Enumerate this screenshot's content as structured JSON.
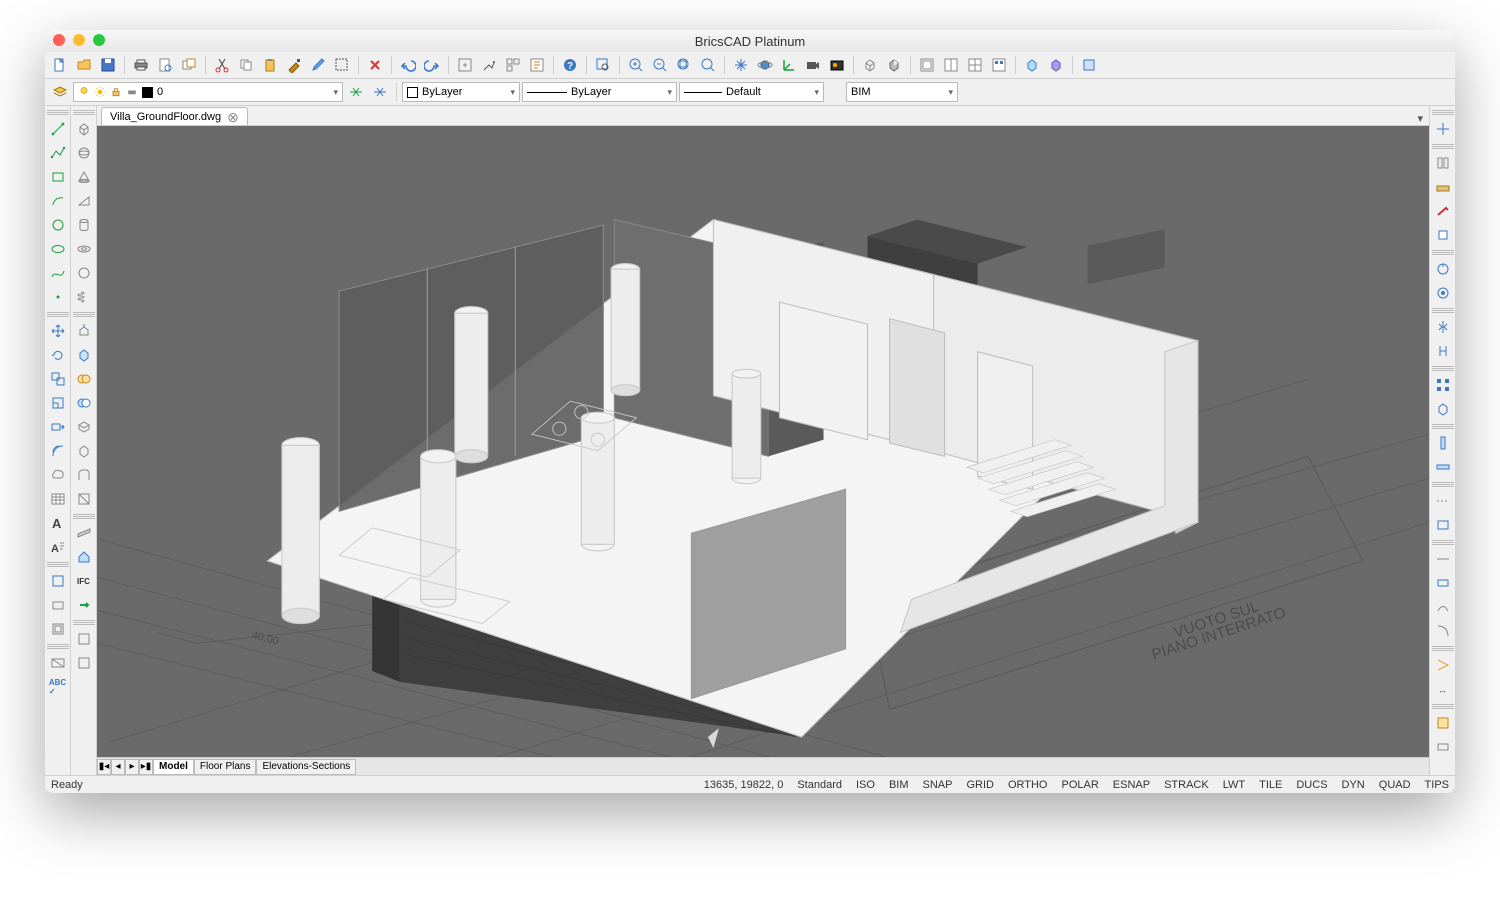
{
  "app_title": "BricsCAD Platinum",
  "document_tab": "Villa_GroundFloor.dwg",
  "workspace": "BIM",
  "layer_combo": "0",
  "color_combo": "ByLayer",
  "linetype_combo": "ByLayer",
  "lineweight_combo": "Default",
  "layout_tabs": {
    "active": "Model",
    "others": [
      "Floor Plans",
      "Elevations-Sections"
    ]
  },
  "status_left": "Ready",
  "status_coords": "13635, 19822, 0",
  "status_toggles": [
    "Standard",
    "ISO",
    "BIM",
    "SNAP",
    "GRID",
    "ORTHO",
    "POLAR",
    "ESNAP",
    "STRACK",
    "LWT",
    "TILE",
    "DUCS",
    "DYN",
    "QUAD",
    "TIPS"
  ],
  "scene_annotations": {
    "side_dim": "40,00",
    "basement_note_1": "VUOTO SUL",
    "basement_note_2": "PIANO INTERRATO"
  }
}
